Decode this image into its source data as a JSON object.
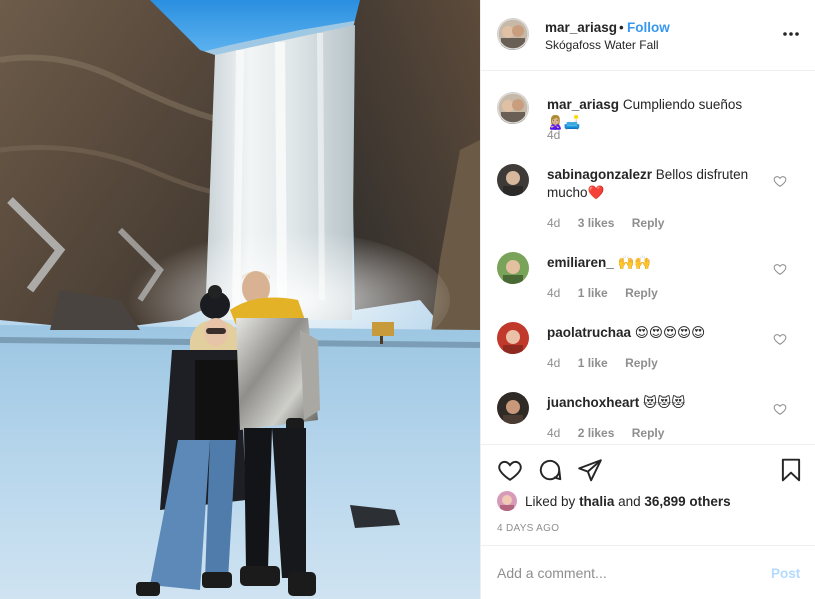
{
  "post": {
    "photo_alt": "",
    "header": {
      "username": "mar_ariasg",
      "separator": "•",
      "follow_label": "Follow",
      "location": "Skógafoss Water Fall",
      "more_icon": "more-horizontal-icon"
    },
    "caption": {
      "username": "mar_ariasg",
      "text": "Cumpliendo sueños",
      "emoji": "🙎🏼‍♀️🛋️",
      "time": "4d"
    },
    "comments": [
      {
        "username": "sabinagonzalezr",
        "text": "Bellos disfruten mucho",
        "emoji": "❤️",
        "time": "4d",
        "likes": "3 likes",
        "reply": "Reply"
      },
      {
        "username": "emiliaren_",
        "text": "",
        "emoji": "🙌🙌",
        "time": "4d",
        "likes": "1 like",
        "reply": "Reply"
      },
      {
        "username": "paolatruchaa",
        "text": "",
        "emoji": "😍😍😍😍😍",
        "time": "4d",
        "likes": "1 like",
        "reply": "Reply"
      },
      {
        "username": "juanchoxheart",
        "text": "",
        "emoji": "😻😻😻",
        "time": "4d",
        "likes": "2 likes",
        "reply": "Reply"
      }
    ],
    "actions": {
      "like_icon": "heart-icon",
      "comment_icon": "comment-icon",
      "share_icon": "share-icon",
      "save_icon": "bookmark-icon"
    },
    "liked_by": {
      "prefix": "Liked by",
      "user": "thalia",
      "connector": "and",
      "count": "36,899 others"
    },
    "time_ago": "4 DAYS AGO",
    "add_comment": {
      "placeholder": "Add a comment...",
      "post_label": "Post"
    },
    "colors": {
      "link_blue": "#3897f0",
      "post_disabled": "#b3dbff",
      "secondary_text": "#8e8e8e",
      "border": "#efefef"
    }
  }
}
